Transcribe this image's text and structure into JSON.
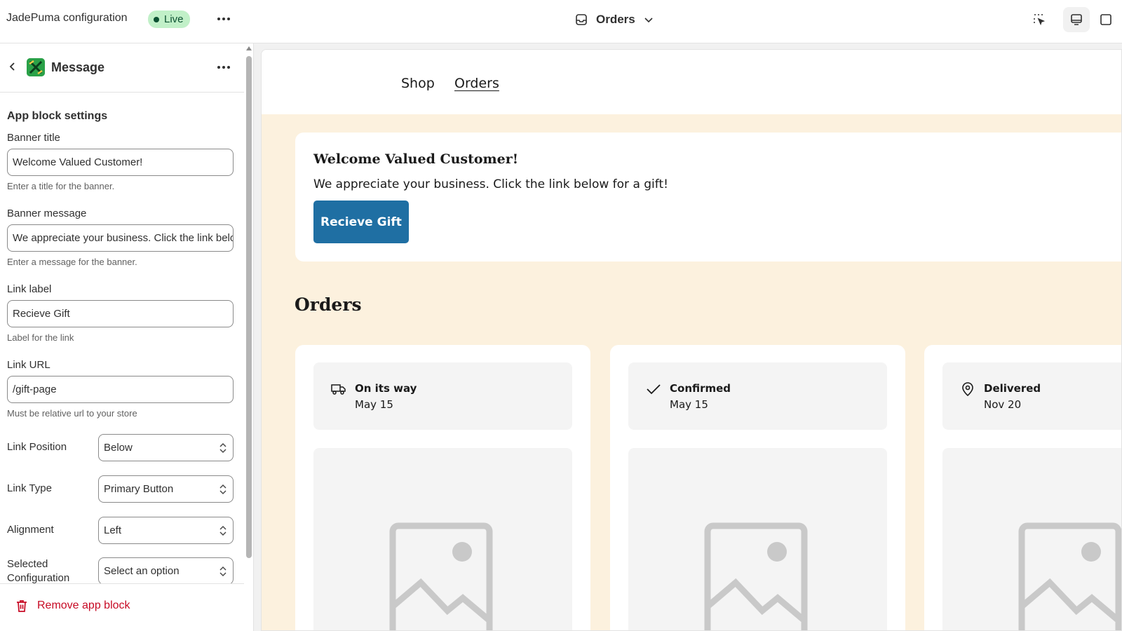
{
  "topbar": {
    "app_title": "JadePuma configuration",
    "live_label": "Live",
    "template_label": "Orders"
  },
  "sidebar": {
    "title": "Message",
    "section_heading": "App block settings",
    "fields": {
      "banner_title": {
        "label": "Banner title",
        "value": "Welcome Valued Customer!",
        "help": "Enter a title for the banner."
      },
      "banner_message": {
        "label": "Banner message",
        "value": "We appreciate your business. Click the link below for a gift!",
        "help": "Enter a message for the banner."
      },
      "link_label": {
        "label": "Link label",
        "value": "Recieve Gift",
        "help": "Label for the link"
      },
      "link_url": {
        "label": "Link URL",
        "value": "/gift-page",
        "help": "Must be relative url to your store"
      }
    },
    "selects": {
      "link_position": {
        "label": "Link Position",
        "value": "Below"
      },
      "link_type": {
        "label": "Link Type",
        "value": "Primary Button"
      },
      "alignment": {
        "label": "Alignment",
        "value": "Left"
      },
      "selected_configuration": {
        "label_line1": "Selected",
        "label_line2": "Configuration",
        "value": "Select an option"
      }
    },
    "remove_label": "Remove app block"
  },
  "preview": {
    "nav": {
      "shop": "Shop",
      "orders": "Orders"
    },
    "banner": {
      "title": "Welcome Valued Customer!",
      "message": "We appreciate your business. Click the link below for a gift!",
      "button": "Recieve Gift"
    },
    "orders_heading": "Orders",
    "orders": [
      {
        "status": "On its way",
        "date": "May 15",
        "icon": "delivery-truck-icon"
      },
      {
        "status": "Confirmed",
        "date": "May 15",
        "icon": "checkmark-icon"
      },
      {
        "status": "Delivered",
        "date": "Nov 20",
        "icon": "location-pin-icon"
      }
    ]
  },
  "colors": {
    "live_bg": "#c1f0c8",
    "button_blue": "#1f6fa3",
    "store_bg": "#fcf1de",
    "danger": "#c70a24"
  }
}
